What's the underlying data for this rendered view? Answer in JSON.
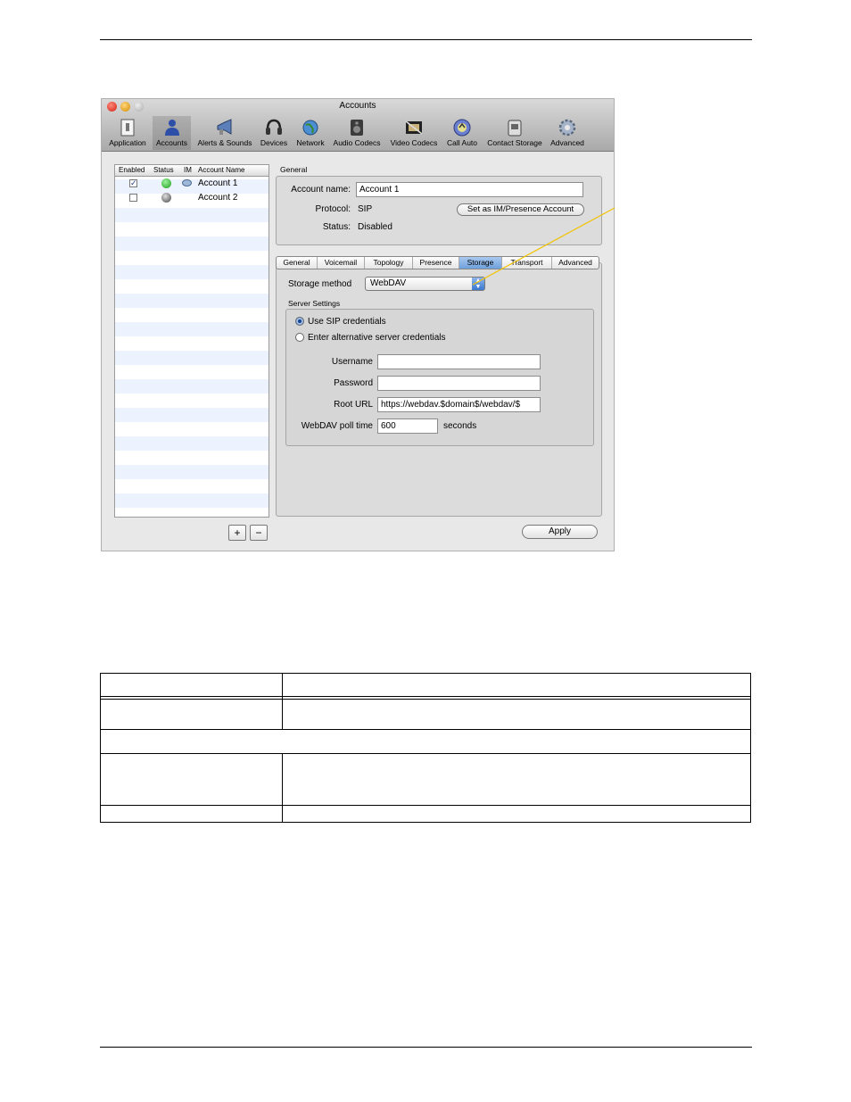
{
  "window": {
    "title": "Accounts",
    "toolbar": [
      {
        "label": "Application",
        "icon": "application-icon"
      },
      {
        "label": "Accounts",
        "icon": "accounts-icon"
      },
      {
        "label": "Alerts & Sounds",
        "icon": "megaphone-icon"
      },
      {
        "label": "Devices",
        "icon": "headset-icon"
      },
      {
        "label": "Network",
        "icon": "globe-icon"
      },
      {
        "label": "Audio Codecs",
        "icon": "speaker-icon"
      },
      {
        "label": "Video Codecs",
        "icon": "film-icon"
      },
      {
        "label": "Call Auto",
        "icon": "call-auto-icon"
      },
      {
        "label": "Contact Storage",
        "icon": "contact-storage-icon"
      },
      {
        "label": "Advanced",
        "icon": "gear-icon"
      }
    ]
  },
  "account_list": {
    "headers": [
      "Enabled",
      "Status",
      "IM",
      "Account Name"
    ],
    "rows": [
      {
        "enabled": true,
        "status": "online",
        "im": true,
        "name": "Account 1"
      },
      {
        "enabled": false,
        "status": "offline",
        "im": false,
        "name": "Account 2"
      }
    ],
    "add_label": "+",
    "remove_label": "−"
  },
  "general": {
    "group_label": "General",
    "account_name_label": "Account name:",
    "account_name_value": "Account 1",
    "protocol_label": "Protocol:",
    "protocol_value": "SIP",
    "status_label": "Status:",
    "status_value": "Disabled",
    "im_button": "Set as IM/Presence Account"
  },
  "tabs": [
    "General",
    "Voicemail",
    "Topology",
    "Presence",
    "Storage",
    "Transport",
    "Advanced"
  ],
  "selected_tab": "Storage",
  "storage": {
    "method_label": "Storage method",
    "method_value": "WebDAV",
    "server_settings_label": "Server Settings",
    "radio_sip": "Use SIP credentials",
    "radio_alt": "Enter alternative server credentials",
    "username_label": "Username",
    "username_value": "",
    "password_label": "Password",
    "password_value": "",
    "root_url_label": "Root URL",
    "root_url_value": "https://webdav.$domain$/webdav/$",
    "poll_label": "WebDAV poll time",
    "poll_value": "600",
    "poll_unit": "seconds"
  },
  "apply_label": "Apply",
  "colors": {
    "callout": "#f2c200",
    "selected_tab": "#7aa8e2",
    "status_green": "#2fbf2f"
  }
}
